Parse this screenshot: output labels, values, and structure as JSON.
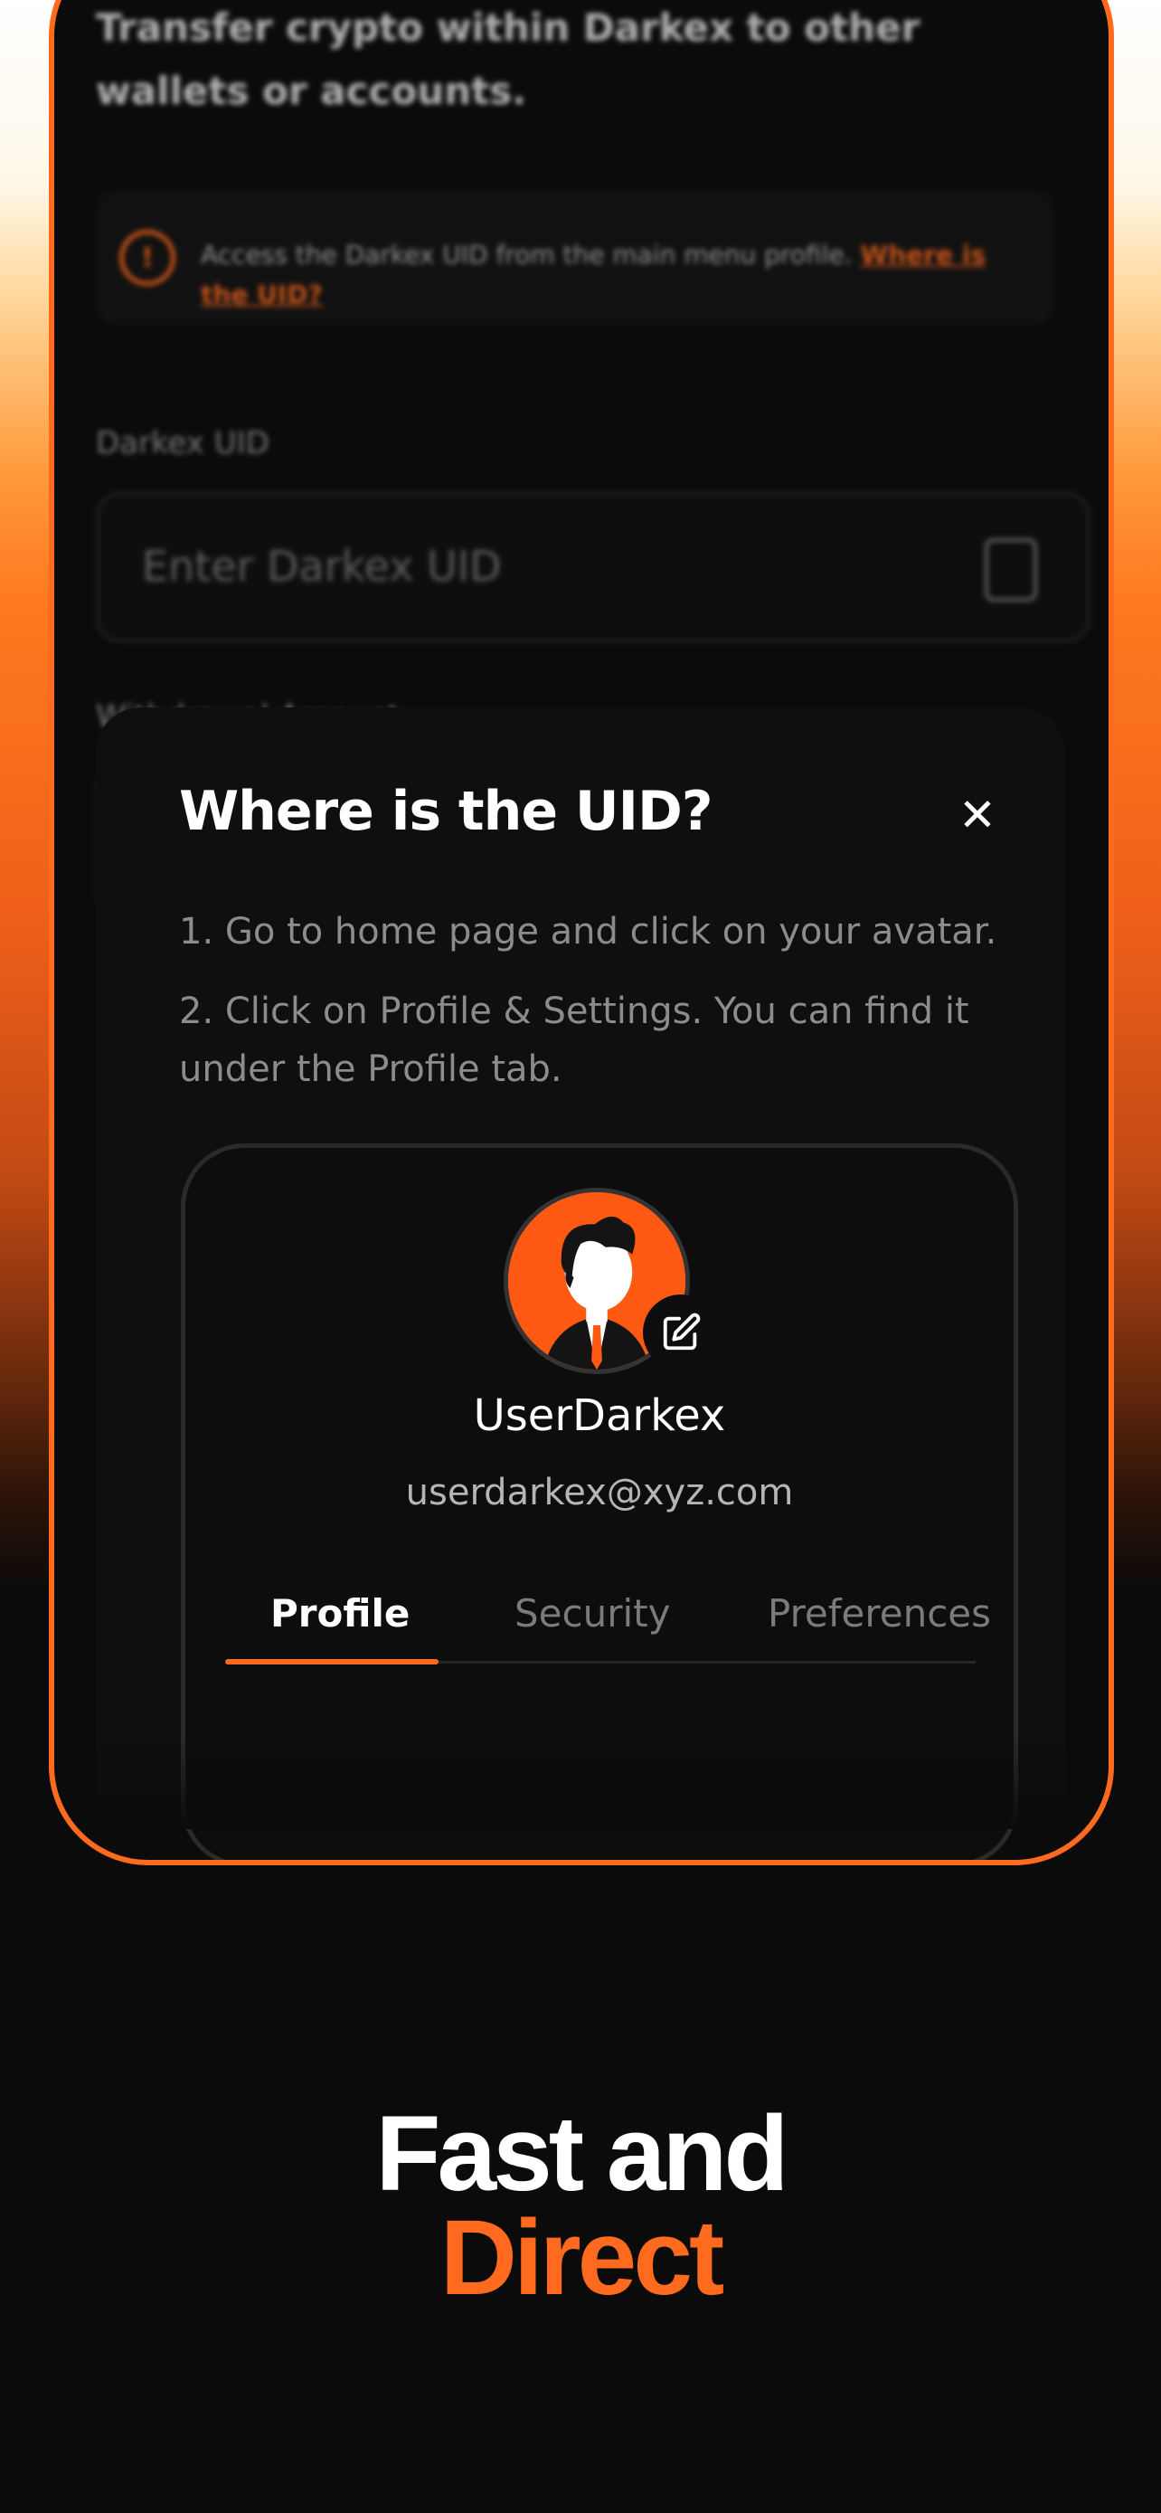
{
  "background_screen": {
    "description": "Transfer crypto within Darkex to other wallets or accounts.",
    "info_text": "Access the Darkex UID from the main menu profile.",
    "info_link": "Where is the UID?",
    "uid_label": "Darkex UID",
    "uid_placeholder": "Enter Darkex UID",
    "amount_label": "Withdrawal Amount"
  },
  "modal": {
    "title": "Where is the UID?",
    "close_icon": "close-icon",
    "steps": [
      "1. Go to home page and click on your avatar.",
      "2. Click on Profile & Settings. You can find it under the Profile tab."
    ],
    "profile": {
      "username": "UserDarkex",
      "email": "userdarkex@xyz.com",
      "tabs": [
        "Profile",
        "Security",
        "Preferences"
      ],
      "active_tab": "Profile"
    }
  },
  "headline": {
    "line1": "Fast and",
    "line2": "Direct"
  },
  "colors": {
    "accent": "#ff6a1f",
    "background": "#0b0b0b"
  }
}
